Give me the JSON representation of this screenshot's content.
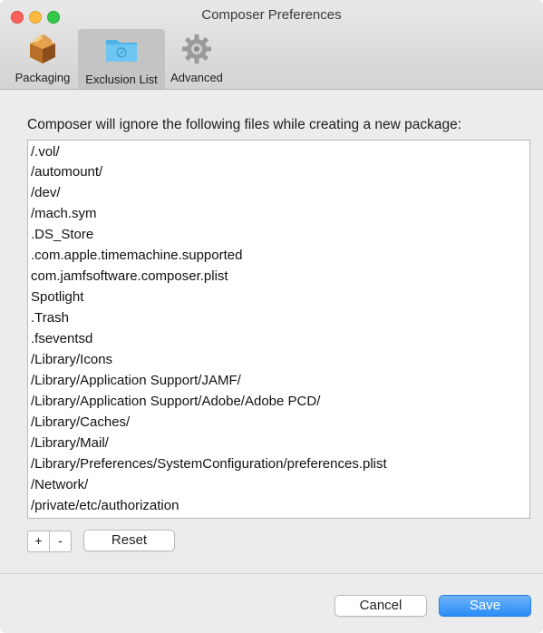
{
  "window": {
    "title": "Composer Preferences"
  },
  "toolbar": {
    "items": [
      {
        "label": "Packaging",
        "icon": "package-box-icon"
      },
      {
        "label": "Exclusion List",
        "icon": "folder-icon"
      },
      {
        "label": "Advanced",
        "icon": "gear-icon"
      }
    ],
    "selected": "Exclusion List"
  },
  "exclusion": {
    "heading": "Composer will ignore the following files while creating a new package:",
    "items": [
      "/.vol/",
      "/automount/",
      "/dev/",
      "/mach.sym",
      ".DS_Store",
      ".com.apple.timemachine.supported",
      "com.jamfsoftware.composer.plist",
      "Spotlight",
      ".Trash",
      ".fseventsd",
      "/Library/Icons",
      "/Library/Application Support/JAMF/",
      "/Library/Application Support/Adobe/Adobe PCD/",
      "/Library/Caches/",
      "/Library/Mail/",
      "/Library/Preferences/SystemConfiguration/preferences.plist",
      "/Network/",
      "/private/etc/authorization"
    ],
    "add_label": "+",
    "remove_label": "-",
    "reset_label": "Reset"
  },
  "footer": {
    "cancel_label": "Cancel",
    "save_label": "Save"
  },
  "colors": {
    "accent": "#2a8cf7",
    "close": "#fc605b",
    "minimize": "#fdbc40",
    "maximize": "#34c84a"
  }
}
